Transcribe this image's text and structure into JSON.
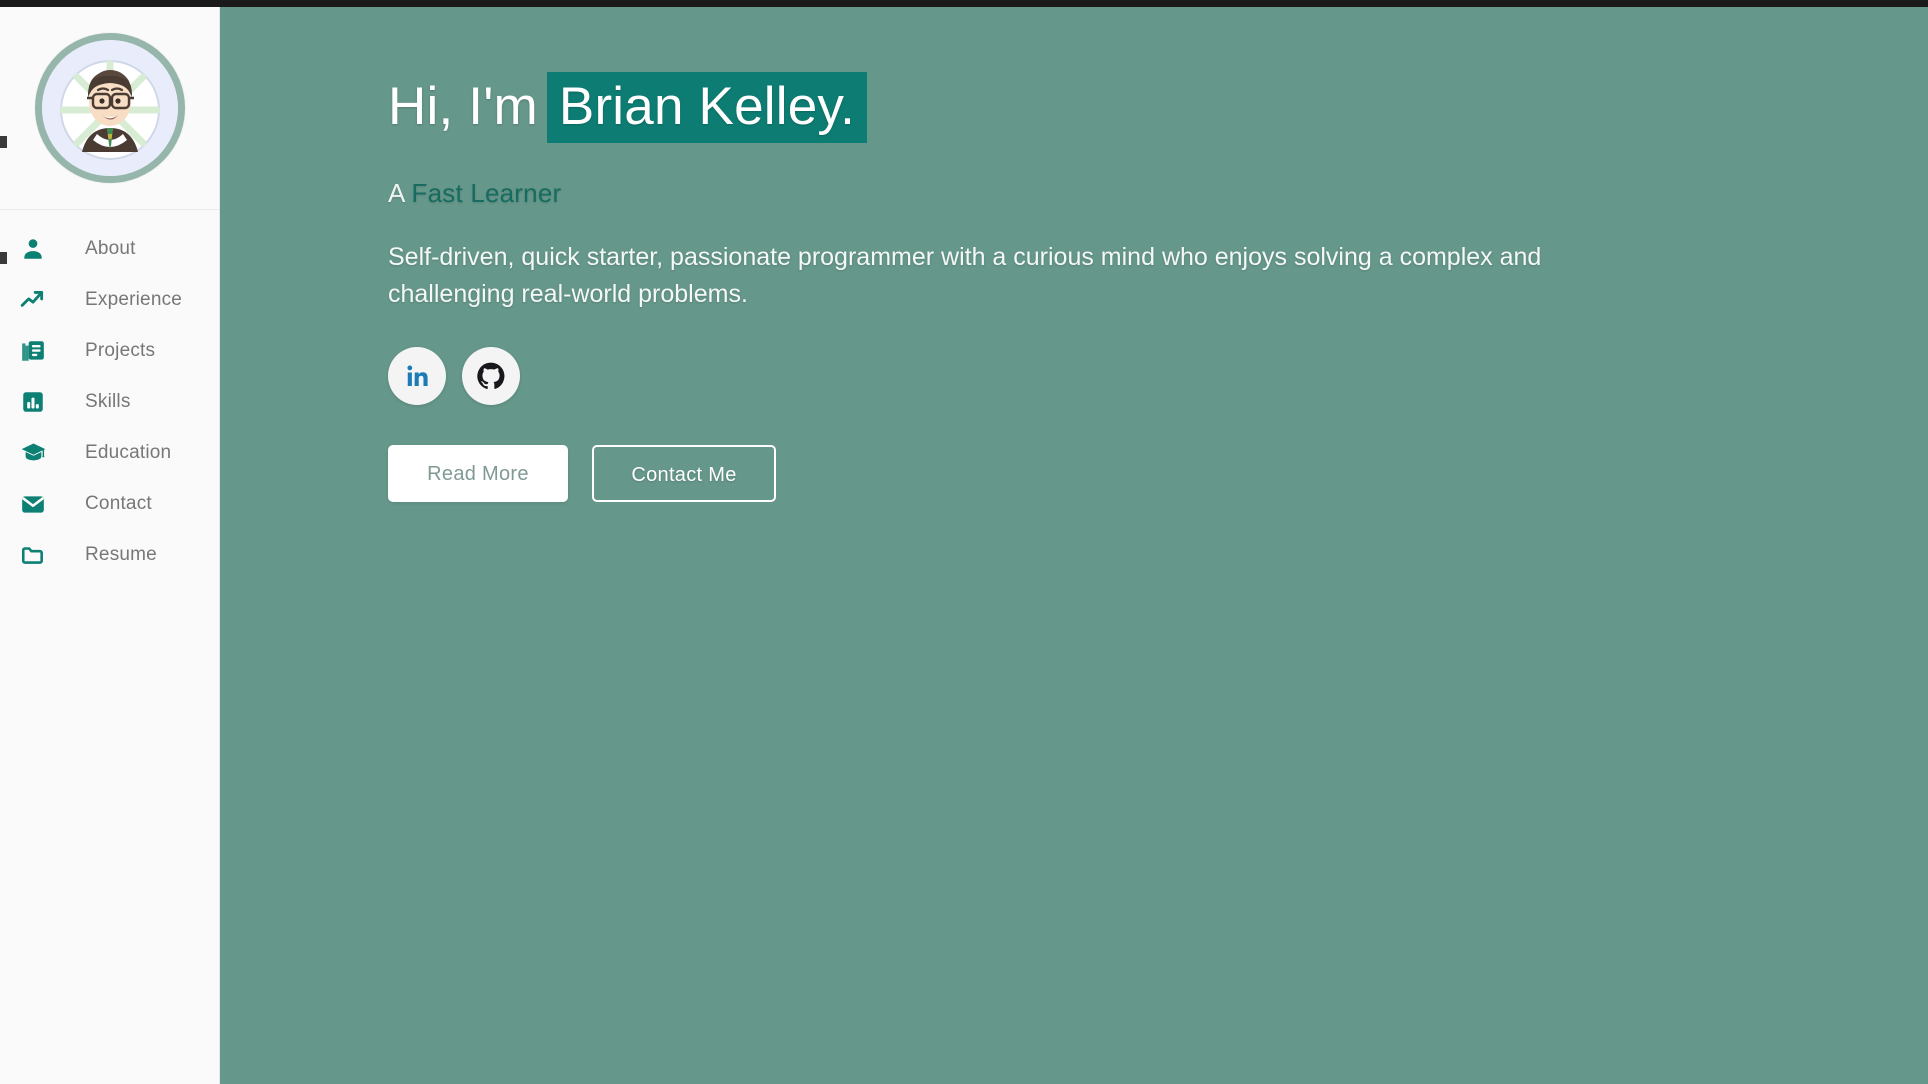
{
  "theme": {
    "main_bg": "#65978a",
    "sidebar_bg": "#fafafa",
    "accent_teal": "#0b8073",
    "highlight_bg": "#0d7d73",
    "nav_text": "#777777",
    "avatar_ring": "#96b6ab"
  },
  "sidebar": {
    "avatar": {
      "alt": "profile-avatar"
    },
    "items": [
      {
        "label": "About",
        "icon": "person-icon"
      },
      {
        "label": "Experience",
        "icon": "trending-up-icon"
      },
      {
        "label": "Projects",
        "icon": "article-icon"
      },
      {
        "label": "Skills",
        "icon": "bar-chart-icon"
      },
      {
        "label": "Education",
        "icon": "graduation-cap-icon"
      },
      {
        "label": "Contact",
        "icon": "envelope-icon"
      },
      {
        "label": "Resume",
        "icon": "folder-icon"
      }
    ]
  },
  "hero": {
    "greeting": "Hi, I'm",
    "name": "Brian Kelley.",
    "subtitle_prefix": "A ",
    "subtitle_accent": "Fast Learner",
    "bio": "Self-driven, quick starter, passionate programmer with a curious mind who enjoys solving a complex and challenging real-world problems.",
    "socials": [
      {
        "name": "linkedin",
        "icon": "linkedin-icon"
      },
      {
        "name": "github",
        "icon": "github-icon"
      }
    ],
    "buttons": {
      "primary": "Read More",
      "secondary": "Contact Me"
    }
  }
}
